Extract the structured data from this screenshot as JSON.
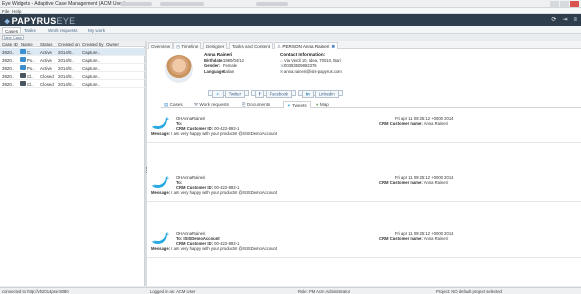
{
  "window": {
    "title": "Eye Widgets - Adaptive Case Management (ACM User)"
  },
  "menu": {
    "file": "File",
    "help": "Help"
  },
  "brand": {
    "bold": "PAPYRUS",
    "light": "EYE"
  },
  "nav_tabs": [
    "Cases",
    "Tasks",
    "Work requests",
    "My work"
  ],
  "new_case_label": "New Case",
  "grid": {
    "columns": [
      "Case ID",
      "Name",
      "Status",
      "Created on",
      "Created by",
      "Owner"
    ],
    "rows": [
      {
        "id": "3920..",
        "name": "C..",
        "status": "Active",
        "created_on": "2014/0..",
        "created_by": "Capture..",
        "owner": "",
        "icon": "blue"
      },
      {
        "id": "3920..",
        "name": "Po..",
        "status": "Active",
        "created_on": "2014/0..",
        "created_by": "Capture..",
        "owner": "",
        "icon": "blue"
      },
      {
        "id": "3920..",
        "name": "Po..",
        "status": "Active",
        "created_on": "2014/0..",
        "created_by": "Capture..",
        "owner": "",
        "icon": "blue"
      },
      {
        "id": "3920..",
        "name": "Cl..",
        "status": "Closed",
        "created_on": "2014/0..",
        "created_by": "Capture..",
        "owner": "",
        "icon": "dark"
      },
      {
        "id": "3920..",
        "name": "Cl..",
        "status": "Closed",
        "created_on": "2014/0..",
        "created_by": "Capture..",
        "owner": "",
        "icon": "dark"
      }
    ]
  },
  "detail_tabs": [
    "Overview",
    "Timeline",
    "Designer",
    "Tasks and Content",
    "PERSON Anna Raineri"
  ],
  "person": {
    "name": "Anna Raineri",
    "birthdate_label": "Birthdate:",
    "birthdate": "1980/04/12",
    "gender_label": "Gender:",
    "gender": "Female",
    "language_label": "Language:",
    "language": "Italian",
    "contact_head": "Contact Information:",
    "address": "Via Verdi 10, Idea, 70010, Bari",
    "phone": "00393509883376",
    "email": "anna.raineri@isis-papyrus.com"
  },
  "social_buttons": [
    "Twitter",
    "Facebook",
    "LinkedIn"
  ],
  "sub_tabs": [
    "Cases",
    "Work requests",
    "Documents",
    "Tweets",
    "Map"
  ],
  "tweet_labels": {
    "to": "To:",
    "cid": "CRM Customer ID:",
    "message": "Message:",
    "cname": "CRM Customer name:"
  },
  "tweets": [
    {
      "user": "OHAnnaRaineri",
      "to": "",
      "customer_id": "00-422-893-1",
      "message": "I am very happy with your products! @ISISDemoAccount",
      "date": "Fri apr 11 09:25:12 +0000 2014",
      "customer_name": "Anna Raineri"
    },
    {
      "user": "OHAnnaRaineri",
      "to": "",
      "customer_id": "00-422-893-1",
      "message": "I am very happy with your products! @ISISDemoAccount",
      "date": "Fri apr 11 09:25:12 +0000 2014",
      "customer_name": "Anna Raineri"
    },
    {
      "user": "OHAnnaRaineri",
      "to": "ISISDemoAccount",
      "customer_id": "00-422-893-1",
      "message": "I am very happy with your products! @ISISDemoAccount",
      "date": "Fri apr 11 09:25:12 +0000 2014",
      "customer_name": "Anna Raineri"
    }
  ],
  "status": {
    "connected": "connected to http://vh2014pse:8080",
    "logged": "Logged in as: ACM User",
    "role": "Role: PM Acm Administrator",
    "project": "Project: NO default project selected"
  },
  "colors": {
    "brand_bar": "#2f3e4c",
    "accent": "#3a8fd1",
    "twitter": "#29a9e1"
  }
}
